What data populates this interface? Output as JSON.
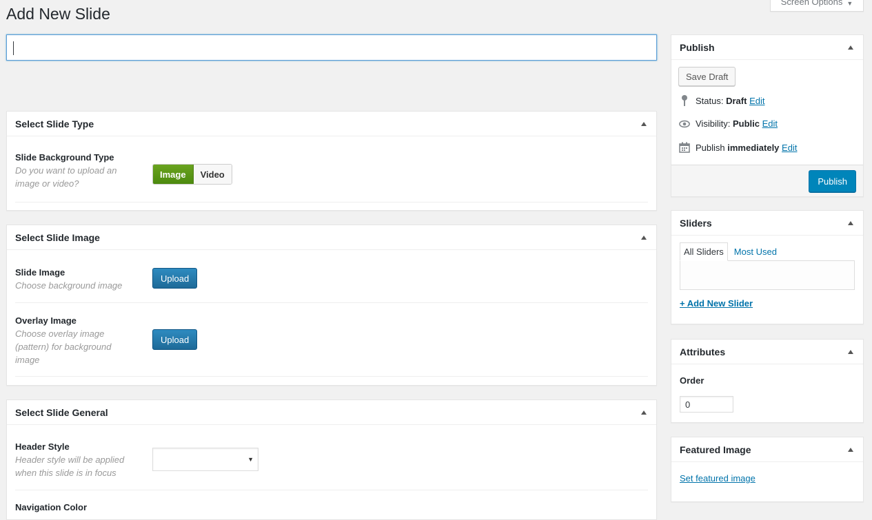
{
  "page": {
    "title": "Add New Slide",
    "screen_options": "Screen Options"
  },
  "title_input": {
    "value": ""
  },
  "slide_type": {
    "heading": "Select Slide Type",
    "bg_type": {
      "label": "Slide Background Type",
      "desc_line1": "Do you want to upload an",
      "desc_line2": "image or video?",
      "options": [
        "Image",
        "Video"
      ],
      "selected": "Image"
    }
  },
  "slide_image": {
    "heading": "Select Slide Image",
    "image": {
      "label": "Slide Image",
      "desc": "Choose background image",
      "button": "Upload"
    },
    "overlay": {
      "label": "Overlay Image",
      "desc_line1": "Choose overlay image",
      "desc_line2": "(pattern) for background",
      "desc_line3": "image",
      "button": "Upload"
    }
  },
  "slide_general": {
    "heading": "Select Slide General",
    "header_style": {
      "label": "Header Style",
      "desc_line1": "Header style will be applied",
      "desc_line2": "when this slide is in focus",
      "value": ""
    },
    "navigation_color": {
      "label": "Navigation Color"
    }
  },
  "publish": {
    "heading": "Publish",
    "save_draft": "Save Draft",
    "status_label": "Status:",
    "status_value": "Draft",
    "visibility_label": "Visibility:",
    "visibility_value": "Public",
    "publish_label": "Publish",
    "publish_value": "immediately",
    "edit": "Edit",
    "publish_button": "Publish"
  },
  "sliders": {
    "heading": "Sliders",
    "tabs": [
      "All Sliders",
      "Most Used"
    ],
    "add_new": "+ Add New Slider"
  },
  "attributes": {
    "heading": "Attributes",
    "order_label": "Order",
    "order_value": "0"
  },
  "featured_image": {
    "heading": "Featured Image",
    "link": "Set featured image"
  },
  "colors": {
    "primary": "#0085ba",
    "link": "#0073aa",
    "toggle_on": "#5d9818",
    "upload": "#2a7bb0"
  },
  "icons": [
    "pin-icon",
    "eye-icon",
    "calendar-icon",
    "triangle-up-icon",
    "triangle-down-icon"
  ]
}
